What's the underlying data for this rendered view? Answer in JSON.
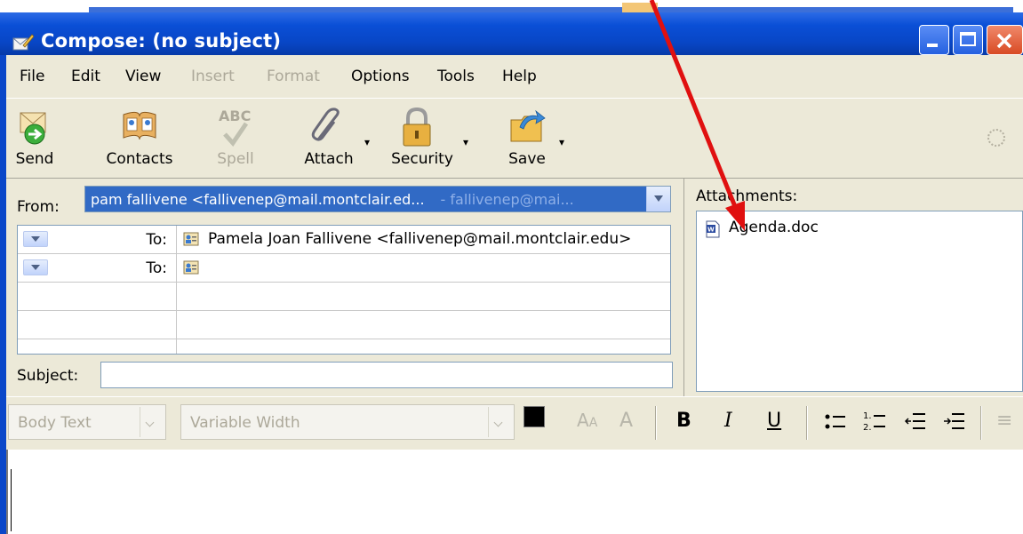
{
  "window": {
    "title": "Compose: (no subject)"
  },
  "menu": {
    "items": [
      {
        "label": "File",
        "enabled": true
      },
      {
        "label": "Edit",
        "enabled": true
      },
      {
        "label": "View",
        "enabled": true
      },
      {
        "label": "Insert",
        "enabled": false
      },
      {
        "label": "Format",
        "enabled": false
      },
      {
        "label": "Options",
        "enabled": true
      },
      {
        "label": "Tools",
        "enabled": true
      },
      {
        "label": "Help",
        "enabled": true
      }
    ]
  },
  "toolbar": {
    "send_label": "Send",
    "contacts_label": "Contacts",
    "spell_label": "Spell",
    "spell_icon_text": "ABC",
    "attach_label": "Attach",
    "security_label": "Security",
    "save_label": "Save"
  },
  "header": {
    "from_label": "From:",
    "from_value": "pam fallivene <fallivenep@mail.montclair.ed...",
    "from_account": "- fallivenep@mai...",
    "recipients": [
      {
        "type": "To:",
        "address": "Pamela Joan Fallivene <fallivenep@mail.montclair.edu>"
      },
      {
        "type": "To:",
        "address": ""
      }
    ],
    "subject_label": "Subject:",
    "subject_value": ""
  },
  "attachments": {
    "label": "Attachments:",
    "items": [
      {
        "name": "Agenda.doc",
        "icon": "word-doc-icon"
      }
    ]
  },
  "format": {
    "paragraph_style": "Body Text",
    "font": "Variable Width"
  },
  "colors": {
    "titlebar": "#0a4fd6",
    "selection": "#316ac5",
    "annotation_arrow": "#e01010"
  }
}
